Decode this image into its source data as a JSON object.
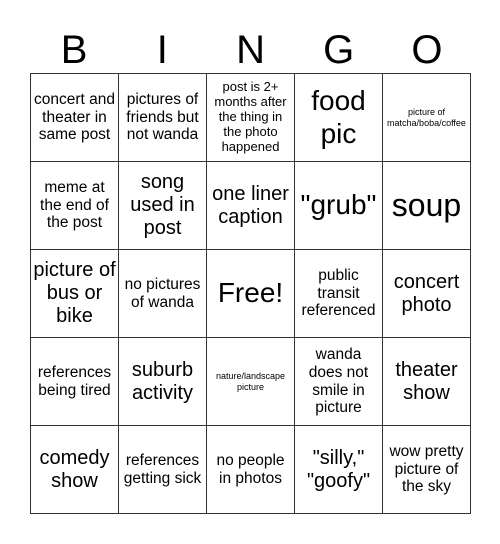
{
  "header": {
    "letters": [
      "B",
      "I",
      "N",
      "G",
      "O"
    ]
  },
  "cells": [
    {
      "text": "concert and theater in same post",
      "size": "s-md"
    },
    {
      "text": "pictures of friends but not wanda",
      "size": "s-md"
    },
    {
      "text": "post is 2+ months after the thing in the photo happened",
      "size": "s-sm"
    },
    {
      "text": "food pic",
      "size": "s-xl"
    },
    {
      "text": "picture of matcha/boba/coffee",
      "size": "s-xs"
    },
    {
      "text": "meme at the end of the post",
      "size": "s-md"
    },
    {
      "text": "song used in post",
      "size": "s-lg"
    },
    {
      "text": "one liner caption",
      "size": "s-lg"
    },
    {
      "text": "\"grub\"",
      "size": "s-xl"
    },
    {
      "text": "soup",
      "size": "s-xxl"
    },
    {
      "text": "picture of bus or bike",
      "size": "s-lg"
    },
    {
      "text": "no pictures of wanda",
      "size": "s-md"
    },
    {
      "text": "Free!",
      "size": "s-xl"
    },
    {
      "text": "public transit referenced",
      "size": "s-md"
    },
    {
      "text": "concert photo",
      "size": "s-lg"
    },
    {
      "text": "references being tired",
      "size": "s-md"
    },
    {
      "text": "suburb activity",
      "size": "s-lg"
    },
    {
      "text": "nature/landscape picture",
      "size": "s-xs"
    },
    {
      "text": "wanda does not smile in picture",
      "size": "s-md"
    },
    {
      "text": "theater show",
      "size": "s-lg"
    },
    {
      "text": "comedy show",
      "size": "s-lg"
    },
    {
      "text": "references getting sick",
      "size": "s-md"
    },
    {
      "text": "no people in photos",
      "size": "s-md"
    },
    {
      "text": "\"silly,\" \"goofy\"",
      "size": "s-lg"
    },
    {
      "text": "wow pretty picture of the sky",
      "size": "s-md"
    }
  ]
}
